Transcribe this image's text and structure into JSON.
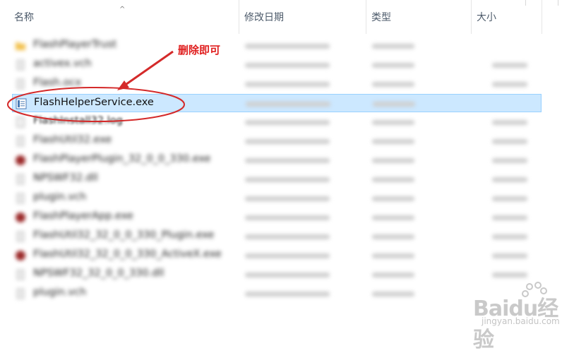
{
  "header": {
    "columns": [
      {
        "label": "名称"
      },
      {
        "label": "修改日期"
      },
      {
        "label": "类型"
      },
      {
        "label": "大小"
      }
    ],
    "sort_indicator": "^"
  },
  "files": [
    {
      "name": "FlashPlayerTrust",
      "icon": "folder-icon",
      "blurred": true
    },
    {
      "name": "activex.vch",
      "icon": "file-icon",
      "blurred": true
    },
    {
      "name": "Flash.ocx",
      "icon": "file-icon",
      "blurred": true
    },
    {
      "name": "FlashHelperService.exe",
      "icon": "exe-icon",
      "blurred": false,
      "selected": true
    },
    {
      "name": "FlashInstall32.log",
      "icon": "log-icon",
      "blurred": true
    },
    {
      "name": "FlashUtil32.exe",
      "icon": "file-icon",
      "blurred": true
    },
    {
      "name": "FlashPlayerPlugin_32_0_0_330.exe",
      "icon": "app-icon",
      "blurred": true
    },
    {
      "name": "NPSWF32.dll",
      "icon": "file-icon",
      "blurred": true
    },
    {
      "name": "plugin.vch",
      "icon": "file-icon",
      "blurred": true
    },
    {
      "name": "FlashPlayerApp.exe",
      "icon": "app-icon",
      "blurred": true
    },
    {
      "name": "FlashUtil32_32_0_0_330_Plugin.exe",
      "icon": "file-icon",
      "blurred": true
    },
    {
      "name": "FlashUtil32_32_0_0_330_ActiveX.exe",
      "icon": "app-icon",
      "blurred": true
    },
    {
      "name": "NPSWF32_32_0_0_330.dll",
      "icon": "file-icon",
      "blurred": true
    },
    {
      "name": "plugin.vch",
      "icon": "file-icon",
      "blurred": true
    }
  ],
  "annotation": {
    "text": "删除即可",
    "color": "#e02020"
  },
  "watermark": {
    "brand": "Baidu经验",
    "url": "jingyan.baidu.com"
  }
}
